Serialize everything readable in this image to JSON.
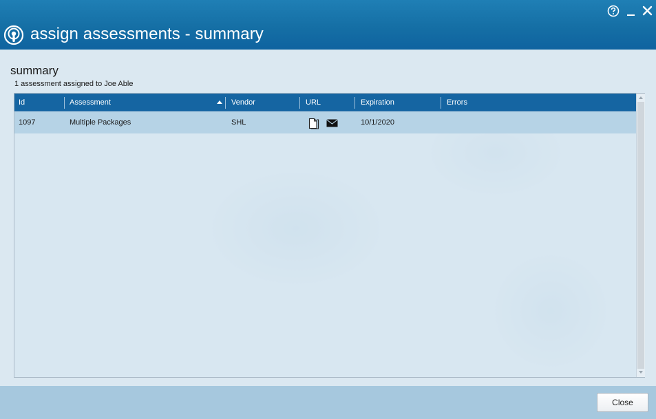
{
  "window": {
    "title": "assign assessments - summary",
    "controls": {
      "help_icon": "help-circle-icon",
      "minimize_icon": "minimize-icon",
      "close_icon": "close-icon"
    }
  },
  "summary": {
    "heading": "summary",
    "subtitle": "1 assessment assigned to Joe Able"
  },
  "table": {
    "columns": [
      "Id",
      "Assessment",
      "Vendor",
      "URL",
      "Expiration",
      "Errors"
    ],
    "sorted_column": "Assessment",
    "sort_direction": "ascending",
    "rows": [
      {
        "id": "1097",
        "assessment": "Multiple Packages",
        "vendor": "SHL",
        "url_icons": [
          "copy-document-icon",
          "email-icon"
        ],
        "expiration": "10/1/2020",
        "errors": ""
      }
    ]
  },
  "footer": {
    "close_label": "Close"
  },
  "colors": {
    "titlebar": "#156fa5",
    "header": "#1565a2",
    "selected_row": "#b6d3e6",
    "footer": "#a6c8de"
  }
}
